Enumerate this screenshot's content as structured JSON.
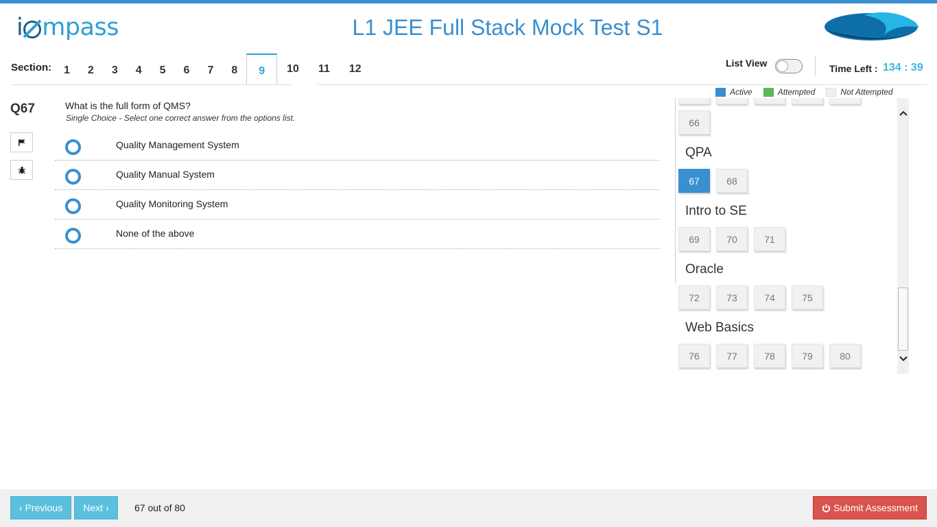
{
  "header": {
    "logo_text_i": "i",
    "logo_text_rest": "mpass",
    "title": "L1 JEE Full Stack Mock Test S1"
  },
  "sections": {
    "label": "Section:",
    "tabs": [
      "1",
      "2",
      "3",
      "4",
      "5",
      "6",
      "7",
      "8",
      "9",
      "10",
      "11",
      "12"
    ],
    "active_tab": "9"
  },
  "controls": {
    "list_view_label": "List View",
    "list_view_on": false,
    "time_label": "Time Left :",
    "time_value": "134 : 39"
  },
  "legend": {
    "active": "Active",
    "attempted": "Attempted",
    "not_attempted": "Not Attempted",
    "colors": {
      "active": "#3a8fd0",
      "attempted": "#5cb85c",
      "not_attempted": "#f1f1f1"
    }
  },
  "question": {
    "number": "Q67",
    "text": "What is the full form of QMS?",
    "hint": "Single Choice - Select one correct answer from the options list.",
    "flag_icon": "flag-icon",
    "bug_icon": "bug-icon",
    "options": [
      "Quality Management System",
      "Quality Manual System",
      "Quality Monitoring System",
      "None of the above"
    ]
  },
  "palette": {
    "groups": [
      {
        "title": "",
        "questions": [
          "66"
        ]
      },
      {
        "title": "QPA",
        "questions": [
          "67",
          "68"
        ]
      },
      {
        "title": "Intro to SE",
        "questions": [
          "69",
          "70",
          "71"
        ]
      },
      {
        "title": "Oracle",
        "questions": [
          "72",
          "73",
          "74",
          "75"
        ]
      },
      {
        "title": "Web Basics",
        "questions": [
          "76",
          "77",
          "78",
          "79",
          "80"
        ]
      }
    ],
    "active_question": "67"
  },
  "footer": {
    "previous_label": "Previous",
    "next_label": "Next",
    "counter": "67 out of 80",
    "submit_label": "Submit Assessment"
  }
}
